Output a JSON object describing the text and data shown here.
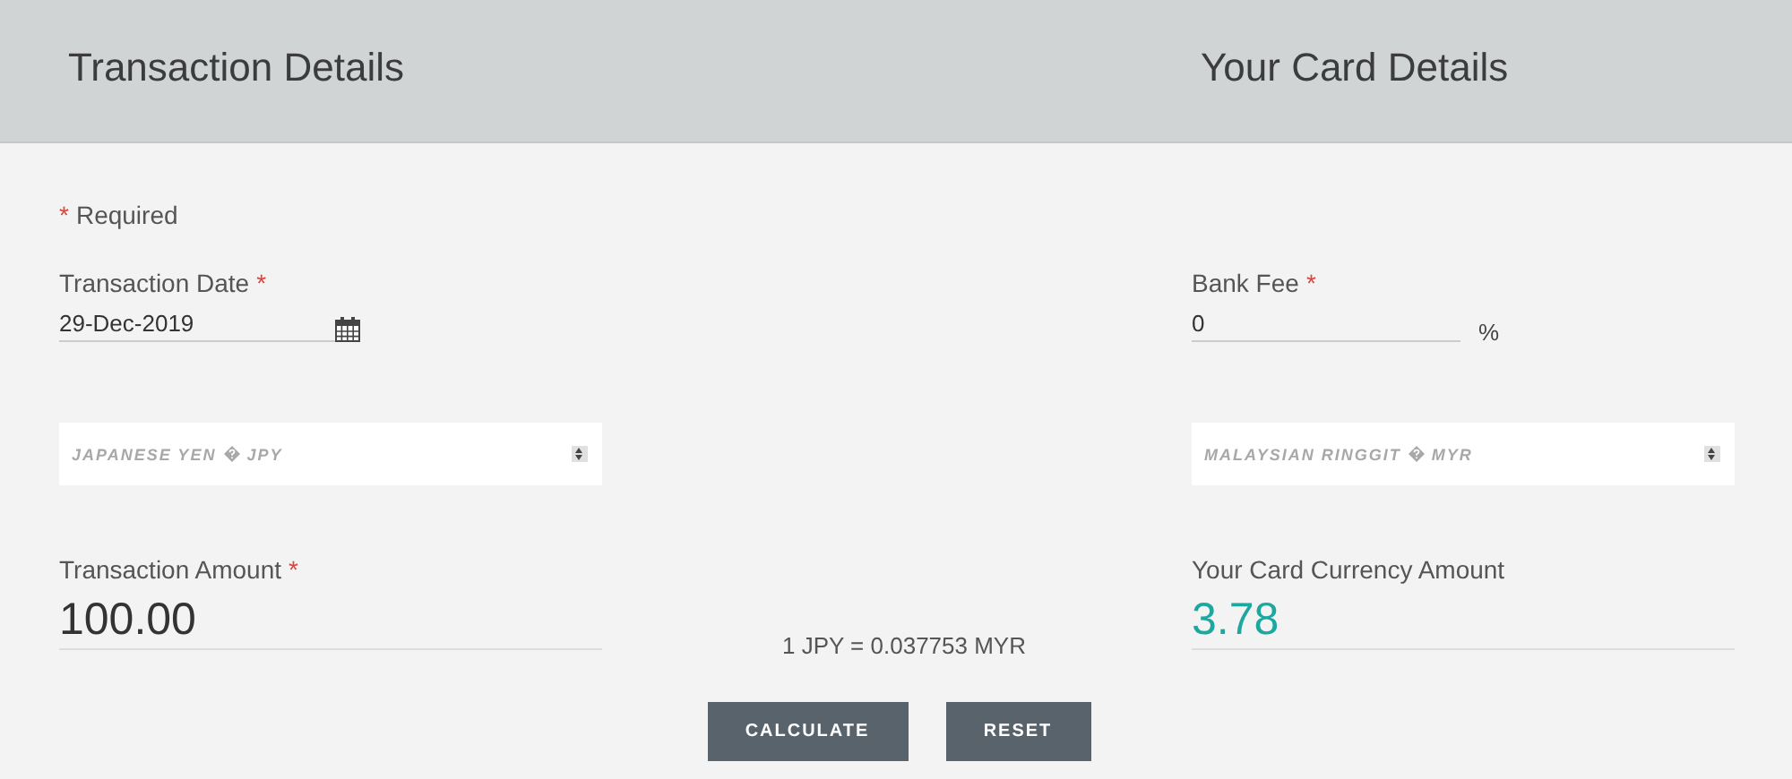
{
  "header": {
    "left_title": "Transaction Details",
    "right_title": "Your Card Details"
  },
  "required_note": {
    "mark": "*",
    "text": "Required"
  },
  "transaction_date": {
    "label": "Transaction Date",
    "mark": "*",
    "value": "29-Dec-2019"
  },
  "from_currency": {
    "name": "JAPANESE YEN",
    "code": "JPY"
  },
  "transaction_amount": {
    "label": "Transaction Amount",
    "mark": "*",
    "value": "100.00"
  },
  "bank_fee": {
    "label": "Bank Fee",
    "mark": "*",
    "value": "0",
    "unit": "%"
  },
  "to_currency": {
    "name": "MALAYSIAN RINGGIT",
    "code": "MYR"
  },
  "card_amount": {
    "label": "Your Card Currency Amount",
    "value": "3.78"
  },
  "rate": "1 JPY = 0.037753 MYR",
  "buttons": [
    "CALCULATE",
    "RESET"
  ]
}
